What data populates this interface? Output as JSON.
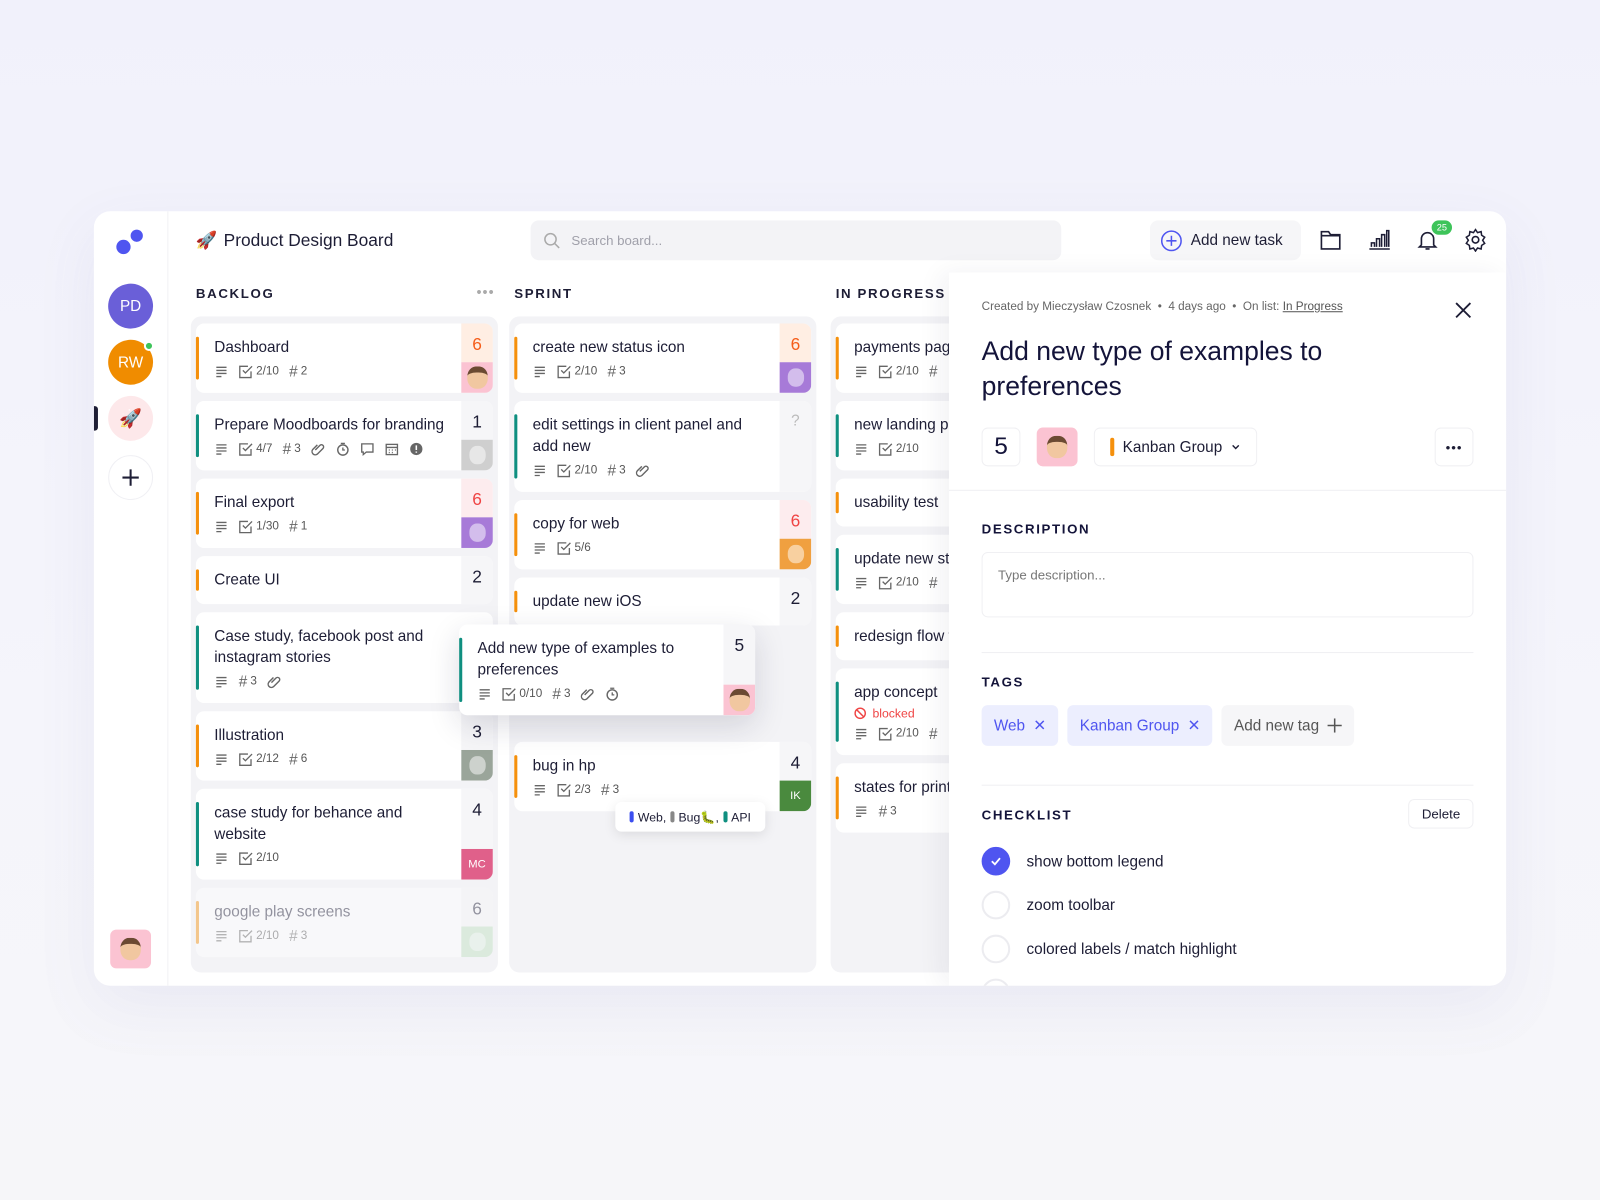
{
  "app": {
    "title": "Product Design Board",
    "title_icon": "rocket-icon"
  },
  "sidebar": {
    "workspaces": [
      {
        "initials": "PD",
        "color": "#6a5fd8"
      },
      {
        "initials": "RW",
        "color": "#f08c00",
        "online": true
      },
      {
        "icon": "rocket-icon",
        "color": "#fde8ea",
        "active": true
      }
    ],
    "add_icon": "plus-icon"
  },
  "header": {
    "search_placeholder": "Search board...",
    "add_task_label": "Add new task",
    "notifications_count": "25"
  },
  "colors": {
    "accent": "#4f55f0",
    "orange": "#f5900c",
    "teal": "#0f8f80",
    "blocked": "#ef4444"
  },
  "columns": [
    {
      "title": "BACKLOG",
      "cards": [
        {
          "title": "Dashboard",
          "stripe": "orange",
          "meta": [
            {
              "icon": "description"
            },
            {
              "icon": "checklist",
              "text": "2/10"
            },
            {
              "icon": "hash",
              "text": "2"
            }
          ],
          "points": "6",
          "points_style": "warm",
          "avatar": {
            "type": "face",
            "bg": "#fbc3d2"
          }
        },
        {
          "title": "Prepare Moodboards for branding",
          "stripe": "teal",
          "meta": [
            {
              "icon": "description"
            },
            {
              "icon": "checklist",
              "text": "4/7"
            },
            {
              "icon": "hash",
              "text": "3"
            },
            {
              "icon": "attachment"
            },
            {
              "icon": "clock"
            },
            {
              "icon": "comment"
            },
            {
              "icon": "calendar"
            },
            {
              "icon": "alert"
            }
          ],
          "points": "1",
          "points_style": "plain",
          "avatar": {
            "type": "photo",
            "bg": "#cfcfcf"
          }
        },
        {
          "title": "Final export",
          "stripe": "orange",
          "meta": [
            {
              "icon": "description"
            },
            {
              "icon": "checklist",
              "text": "1/30"
            },
            {
              "icon": "hash",
              "text": "1"
            }
          ],
          "points": "6",
          "points_style": "red",
          "avatar": {
            "type": "photo",
            "bg": "#a77ad8"
          }
        },
        {
          "title": "Create UI",
          "stripe": "orange",
          "meta": [],
          "points": "2",
          "points_style": "plain"
        },
        {
          "title": "Case study, facebook post and instagram stories",
          "stripe": "teal",
          "meta": [
            {
              "icon": "description"
            },
            {
              "icon": "hash",
              "text": "3"
            },
            {
              "icon": "attachment"
            }
          ]
        },
        {
          "title": "Illustration",
          "stripe": "orange",
          "meta": [
            {
              "icon": "description"
            },
            {
              "icon": "checklist",
              "text": "2/12"
            },
            {
              "icon": "hash",
              "text": "6"
            }
          ],
          "points": "3",
          "points_style": "plain",
          "avatar": {
            "type": "photo",
            "bg": "#9aa59a"
          }
        },
        {
          "title": "case study for behance and website",
          "stripe": "teal",
          "meta": [
            {
              "icon": "description"
            },
            {
              "icon": "checklist",
              "text": "2/10"
            }
          ],
          "points": "4",
          "points_style": "plain",
          "avatar": {
            "type": "initials",
            "initials": "MC",
            "bg": "#e0608a"
          }
        },
        {
          "title": "google play screens",
          "stripe": "orange",
          "faded": true,
          "meta": [
            {
              "icon": "description"
            },
            {
              "icon": "checklist",
              "text": "2/10"
            },
            {
              "icon": "hash",
              "text": "3"
            }
          ],
          "points": "6",
          "points_style": "plain",
          "avatar": {
            "type": "photo",
            "bg": "#bfe0c0"
          }
        }
      ]
    },
    {
      "title": "SPRINT",
      "cards": [
        {
          "title": "create new status icon",
          "stripe": "orange",
          "meta": [
            {
              "icon": "description"
            },
            {
              "icon": "checklist",
              "text": "2/10"
            },
            {
              "icon": "hash",
              "text": "3"
            }
          ],
          "points": "6",
          "points_style": "warm",
          "avatar": {
            "type": "photo",
            "bg": "#a77ad8"
          }
        },
        {
          "title": "edit settings in client panel and add new",
          "stripe": "teal",
          "meta": [
            {
              "icon": "description"
            },
            {
              "icon": "checklist",
              "text": "2/10"
            },
            {
              "icon": "hash",
              "text": "3"
            },
            {
              "icon": "attachment"
            }
          ],
          "points": "?",
          "points_style": "muted"
        },
        {
          "title": "copy for web",
          "stripe": "orange",
          "meta": [
            {
              "icon": "description"
            },
            {
              "icon": "checklist",
              "text": "5/6"
            }
          ],
          "points": "6",
          "points_style": "red",
          "avatar": {
            "type": "photo",
            "bg": "#f0a040"
          }
        },
        {
          "title": "update new iOS",
          "stripe": "orange",
          "meta": [],
          "points": "2",
          "points_style": "plain"
        },
        {
          "spacer": true
        },
        {
          "title": "bug in hp",
          "stripe": "orange",
          "meta": [
            {
              "icon": "description"
            },
            {
              "icon": "checklist",
              "text": "2/3"
            },
            {
              "icon": "hash",
              "text": "3"
            }
          ],
          "points": "4",
          "points_style": "plain",
          "avatar": {
            "type": "initials",
            "initials": "IK",
            "bg": "#4a8a3e"
          }
        }
      ]
    },
    {
      "title": "IN PROGRESS",
      "cards": [
        {
          "title": "payments page",
          "stripe": "orange",
          "meta": [
            {
              "icon": "description"
            },
            {
              "icon": "checklist",
              "text": "2/10"
            },
            {
              "icon": "hash",
              "text": ""
            }
          ]
        },
        {
          "title": "new landing page update",
          "stripe": "teal",
          "meta": [
            {
              "icon": "description"
            },
            {
              "icon": "checklist",
              "text": "2/10"
            }
          ]
        },
        {
          "title": "usability test",
          "stripe": "orange",
          "meta": []
        },
        {
          "title": "update new style design system",
          "stripe": "teal",
          "meta": [
            {
              "icon": "description"
            },
            {
              "icon": "checklist",
              "text": "2/10"
            },
            {
              "icon": "hash",
              "text": ""
            }
          ]
        },
        {
          "title": "redesign flow for new user",
          "stripe": "orange",
          "meta": []
        },
        {
          "title": "app concept",
          "stripe": "teal",
          "status": "blocked",
          "meta": [
            {
              "icon": "description"
            },
            {
              "icon": "checklist",
              "text": "2/10"
            },
            {
              "icon": "hash",
              "text": ""
            }
          ]
        },
        {
          "title": "states for print",
          "stripe": "orange",
          "meta": [
            {
              "icon": "description"
            },
            {
              "icon": "hash",
              "text": "3"
            }
          ]
        }
      ]
    }
  ],
  "dragged_card": {
    "title": "Add new type of examples to preferences",
    "stripe": "teal",
    "meta": [
      {
        "icon": "description"
      },
      {
        "icon": "checklist",
        "text": "0/10"
      },
      {
        "icon": "hash",
        "text": "3"
      },
      {
        "icon": "attachment"
      },
      {
        "icon": "clock"
      }
    ],
    "points": "5",
    "points_style": "plain",
    "avatar": {
      "type": "face",
      "bg": "#fbc3d2"
    }
  },
  "tag_tooltip": {
    "tags": [
      {
        "label": "Web,",
        "color": "#3b4ef0"
      },
      {
        "label": "Bug🐛,",
        "color": "#888"
      },
      {
        "label": "API",
        "color": "#0f8f80"
      }
    ]
  },
  "detail": {
    "created_by": "Created by Mieczysław Czosnek",
    "created_ago": "4 days ago",
    "on_list_label": "On list:",
    "on_list": "In Progress",
    "title": "Add new type of examples to preferences",
    "points": "5",
    "group": "Kanban Group",
    "description_label": "DESCRIPTION",
    "description_placeholder": "Type description...",
    "tags_label": "TAGS",
    "tags": [
      "Web",
      "Kanban Group"
    ],
    "add_tag_label": "Add new tag",
    "checklist_label": "CHECKLIST",
    "delete_label": "Delete",
    "checklist": [
      {
        "label": "show bottom legend",
        "done": true
      },
      {
        "label": "zoom toolbar",
        "done": false
      },
      {
        "label": "colored labels / match highlight",
        "done": false
      }
    ]
  }
}
